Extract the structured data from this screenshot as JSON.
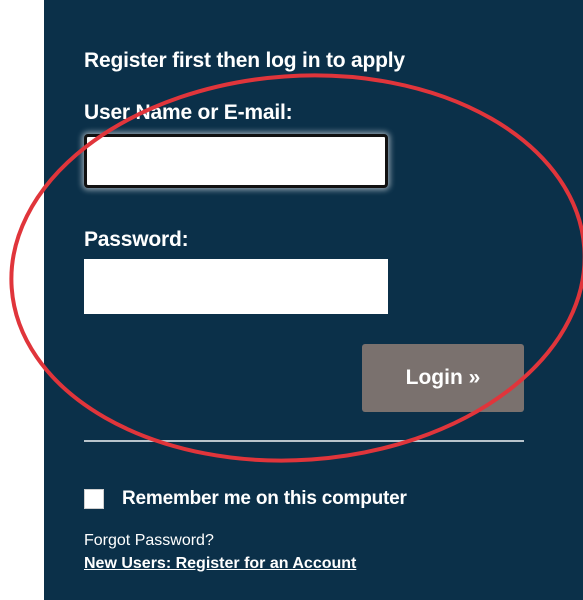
{
  "colors": {
    "panel_background": "#0b3049",
    "login_button": "#7a716e",
    "annotation_circle": "#e0353b"
  },
  "login": {
    "heading": "Register first then log in to apply",
    "username_label": "User Name or E-mail:",
    "username_value": "",
    "password_label": "Password:",
    "password_value": "",
    "login_button_label": "Login »",
    "remember_label": "Remember me on this computer",
    "remember_checked": false,
    "forgot_link": "Forgot Password?",
    "register_link": "New Users: Register for an Account"
  }
}
